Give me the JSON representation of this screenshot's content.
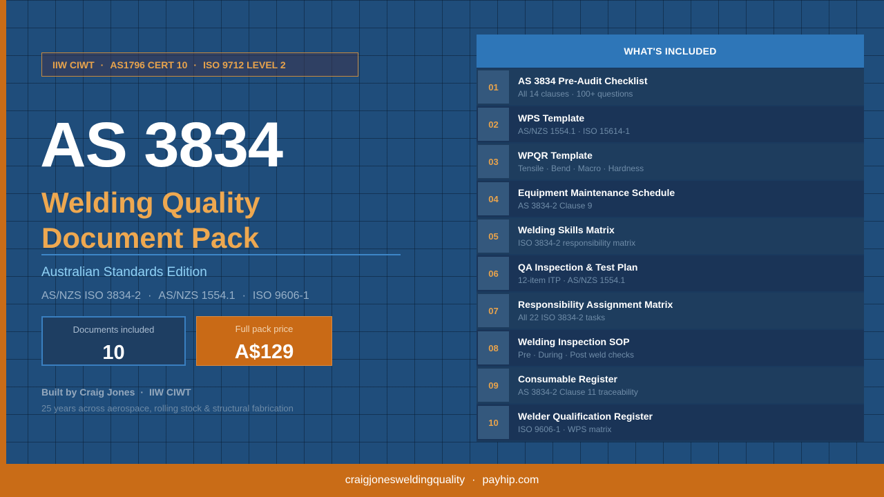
{
  "colors": {
    "background": "#1f4d7b",
    "accent_orange": "#c96c17",
    "title_orange": "#eea850",
    "panel_header": "#2e76b8"
  },
  "cert_bar": {
    "items": [
      "IIW CIWT",
      "AS1796 CERT 10",
      "ISO 9712 LEVEL 2"
    ],
    "separator": "·"
  },
  "title": "AS 3834",
  "subtitle_line1": "Welding Quality",
  "subtitle_line2": "Document Pack",
  "edition": "Australian Standards Edition",
  "standards": {
    "items": [
      "AS/NZS ISO 3834-2",
      "AS/NZS 1554.1",
      "ISO 9606-1"
    ],
    "separator": "·"
  },
  "stats": {
    "documents_label": "Documents included",
    "documents_value": "10",
    "price_label": "Full pack price",
    "price_value": "A$129"
  },
  "author": {
    "built_by": "Built by Craig Jones",
    "separator": "·",
    "credential": "IIW CIWT",
    "experience": "25 years across aerospace, rolling stock & structural fabrication"
  },
  "panel": {
    "header": "WHAT'S INCLUDED",
    "items": [
      {
        "num": "01",
        "title": "AS 3834 Pre-Audit Checklist",
        "sub": "All 14 clauses · 100+ questions"
      },
      {
        "num": "02",
        "title": "WPS Template",
        "sub": "AS/NZS 1554.1 · ISO 15614-1"
      },
      {
        "num": "03",
        "title": "WPQR Template",
        "sub": "Tensile · Bend · Macro · Hardness"
      },
      {
        "num": "04",
        "title": "Equipment Maintenance Schedule",
        "sub": "AS 3834-2 Clause 9"
      },
      {
        "num": "05",
        "title": "Welding Skills Matrix",
        "sub": "ISO 3834-2 responsibility matrix"
      },
      {
        "num": "06",
        "title": "QA Inspection & Test Plan",
        "sub": "12-item ITP · AS/NZS 1554.1"
      },
      {
        "num": "07",
        "title": "Responsibility Assignment Matrix",
        "sub": "All 22 ISO 3834-2 tasks"
      },
      {
        "num": "08",
        "title": "Welding Inspection SOP",
        "sub": "Pre · During · Post weld checks"
      },
      {
        "num": "09",
        "title": "Consumable Register",
        "sub": "AS 3834-2 Clause 11 traceability"
      },
      {
        "num": "10",
        "title": "Welder Qualification Register",
        "sub": "ISO 9606-1 · WPS matrix"
      }
    ]
  },
  "footer": {
    "site": "craigjonesweldingquality",
    "separator": "·",
    "platform": "payhip.com"
  }
}
